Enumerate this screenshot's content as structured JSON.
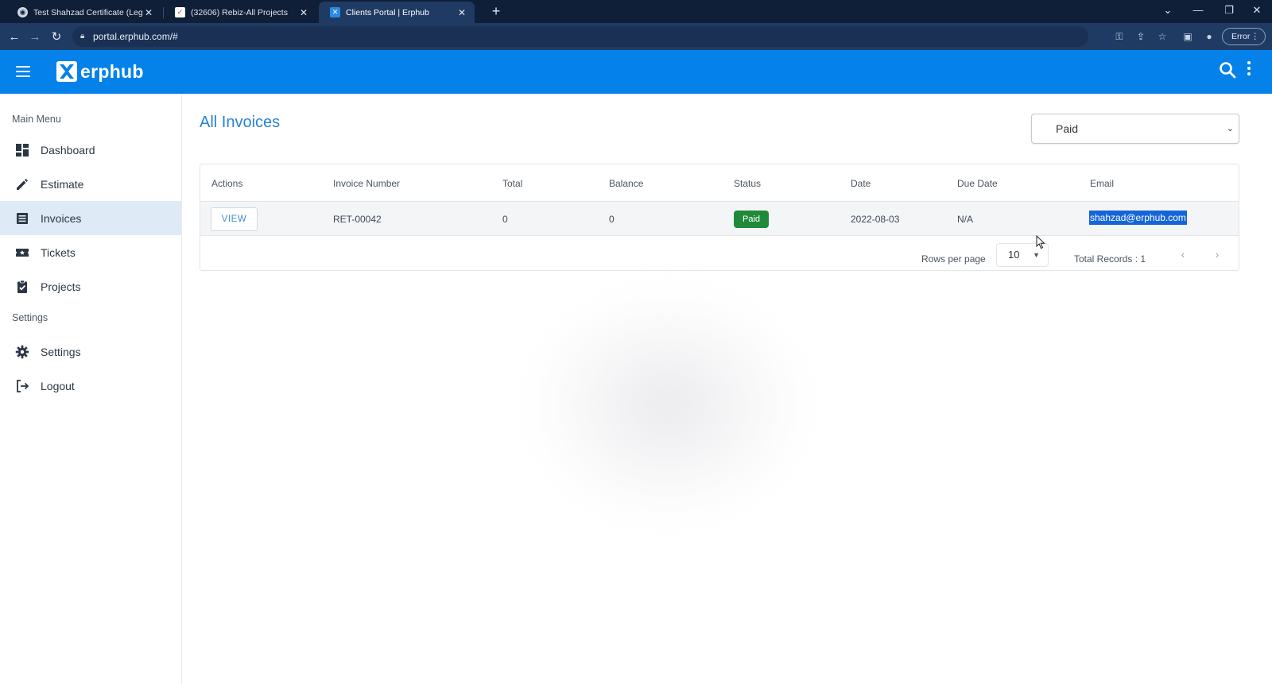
{
  "browser": {
    "tabs": [
      {
        "title": "Test Shahzad Certificate (Legal C",
        "close": "✕"
      },
      {
        "title": "(32606) Rebiz-All Projects",
        "close": "✕"
      },
      {
        "title": "Clients Portal | Erphub",
        "close": "✕"
      }
    ],
    "url": "portal.erphub.com/#",
    "profile_status": "Error"
  },
  "app": {
    "logo_text": "erphub",
    "brand_color": "#0582ea"
  },
  "sidebar": {
    "main_menu_label": "Main Menu",
    "settings_label": "Settings",
    "items": [
      {
        "label": "Dashboard",
        "icon": "dashboard-icon"
      },
      {
        "label": "Estimate",
        "icon": "pencil-icon"
      },
      {
        "label": "Invoices",
        "icon": "list-icon",
        "active": true
      },
      {
        "label": "Tickets",
        "icon": "ticket-icon"
      },
      {
        "label": "Projects",
        "icon": "clipboard-check-icon"
      }
    ],
    "settings_items": [
      {
        "label": "Settings",
        "icon": "gear-icon"
      },
      {
        "label": "Logout",
        "icon": "logout-icon"
      }
    ]
  },
  "main": {
    "title": "All Invoices",
    "filter": {
      "selected": "Paid"
    },
    "table": {
      "columns": [
        "Actions",
        "Invoice Number",
        "Total",
        "Balance",
        "Status",
        "Date",
        "Due Date",
        "Email"
      ],
      "rows": [
        {
          "action_label": "VIEW",
          "invoice_number": "RET-00042",
          "total": "0",
          "balance": "0",
          "status": "Paid",
          "date": "2022-08-03",
          "due_date": "N/A",
          "email": "shahzad@erphub.com"
        }
      ]
    },
    "pagination": {
      "rows_per_page_label": "Rows per page",
      "rows_per_page": "10",
      "total_records": "Total Records : 1"
    }
  },
  "colors": {
    "status_paid": "#1f8a3a",
    "title_blue": "#2a82d6",
    "active_item_bg": "#dfeaf7"
  }
}
